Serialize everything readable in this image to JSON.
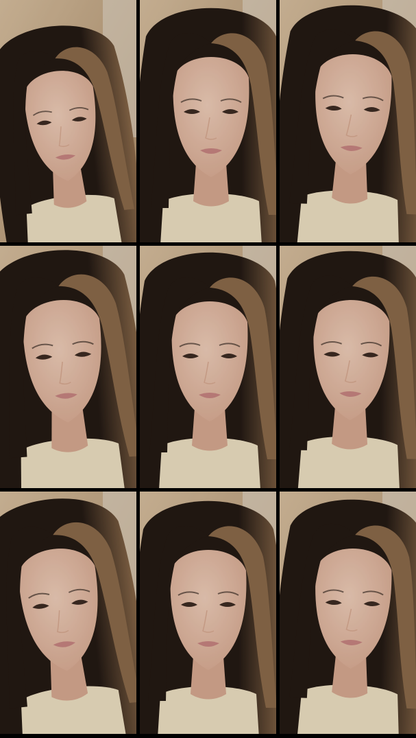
{
  "grid": {
    "rows": 3,
    "columns": 3,
    "frame_count": 9
  },
  "palette": {
    "wall": "#d9c2a2",
    "wall_shadow": "#a88a66",
    "door": "#e8e2d6",
    "hair_dark": "#1f1712",
    "hair_light": "#8a6a4a",
    "skin": "#f1d1bd",
    "skin_shadow": "#d9ab93",
    "lips": "#c98683",
    "shirt": "#efe4c6",
    "eyes": "#3a2a22"
  },
  "frames": [
    {
      "id": 1,
      "pose": "head-tilted-left-talking"
    },
    {
      "id": 2,
      "pose": "centered-slight-smile"
    },
    {
      "id": 3,
      "pose": "centered-looking-down"
    },
    {
      "id": 4,
      "pose": "tilted-smile"
    },
    {
      "id": 5,
      "pose": "centered-smile"
    },
    {
      "id": 6,
      "pose": "centered-neutral"
    },
    {
      "id": 7,
      "pose": "head-tilted-smile"
    },
    {
      "id": 8,
      "pose": "centered-talking"
    },
    {
      "id": 9,
      "pose": "centered-looking-side"
    }
  ]
}
